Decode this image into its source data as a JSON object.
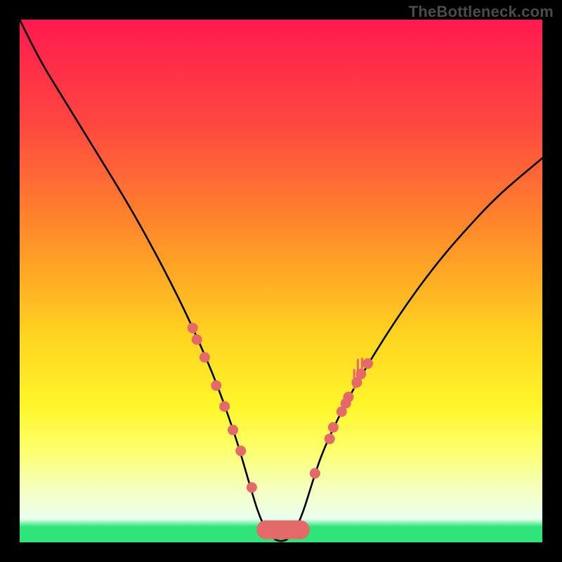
{
  "watermark": "TheBottleneck.com",
  "colors": {
    "frame": "#000000",
    "curve": "#000000",
    "marker": "#e46a6a",
    "bottom_band": "#2fe47a",
    "gradient_stops": [
      {
        "offset": 0.0,
        "color": "#ff1a4f"
      },
      {
        "offset": 0.2,
        "color": "#ff4740"
      },
      {
        "offset": 0.4,
        "color": "#ff8a2a"
      },
      {
        "offset": 0.6,
        "color": "#ffd21f"
      },
      {
        "offset": 0.74,
        "color": "#fff62a"
      },
      {
        "offset": 0.82,
        "color": "#fdff6a"
      },
      {
        "offset": 0.9,
        "color": "#f4ffc0"
      },
      {
        "offset": 0.955,
        "color": "#eaffef"
      },
      {
        "offset": 0.97,
        "color": "#2fe47a"
      },
      {
        "offset": 1.0,
        "color": "#2fe47a"
      }
    ]
  },
  "chart_data": {
    "type": "line",
    "title": "",
    "xlabel": "",
    "ylabel": "",
    "xlim": [
      0,
      100
    ],
    "ylim": [
      0,
      100
    ],
    "series": [
      {
        "name": "curve",
        "x": [
          0,
          4,
          8,
          12,
          16,
          20,
          24,
          28,
          32,
          36,
          38,
          40,
          42,
          44,
          46,
          48,
          50,
          52,
          54,
          56,
          58,
          62,
          66,
          70,
          74,
          78,
          82,
          86,
          90,
          94,
          100
        ],
        "y": [
          100,
          92,
          85.5,
          79,
          72.5,
          66,
          59,
          51.5,
          43.5,
          34.5,
          29.5,
          24,
          18,
          11,
          4.5,
          1,
          0,
          1,
          5,
          11.5,
          17.5,
          26,
          33,
          39.5,
          45.5,
          51,
          56,
          60.5,
          64.8,
          68.5,
          73.5
        ]
      }
    ],
    "markers_left": [
      {
        "x": 33.1,
        "y": 41.0
      },
      {
        "x": 33.9,
        "y": 38.8
      },
      {
        "x": 35.4,
        "y": 35.4
      },
      {
        "x": 37.6,
        "y": 30.0
      },
      {
        "x": 39.2,
        "y": 26.0
      },
      {
        "x": 40.8,
        "y": 21.5
      },
      {
        "x": 42.3,
        "y": 17.5
      },
      {
        "x": 44.4,
        "y": 10.5
      }
    ],
    "markers_right": [
      {
        "x": 56.5,
        "y": 13.2
      },
      {
        "x": 59.3,
        "y": 19.8
      },
      {
        "x": 60.0,
        "y": 22.0
      },
      {
        "x": 61.6,
        "y": 25.0
      },
      {
        "x": 62.4,
        "y": 26.6
      },
      {
        "x": 62.9,
        "y": 27.8
      },
      {
        "x": 64.5,
        "y": 30.6
      },
      {
        "x": 65.3,
        "y": 32.2
      },
      {
        "x": 66.6,
        "y": 34.2
      }
    ],
    "spikes_right": [
      {
        "x": 64.0,
        "h": 3.5
      },
      {
        "x": 64.7,
        "h": 4.2
      },
      {
        "x": 65.5,
        "h": 3.0
      }
    ],
    "bottom_band": {
      "x0": 45.3,
      "x1": 55.5,
      "y": 0.6,
      "h": 3.6
    }
  }
}
